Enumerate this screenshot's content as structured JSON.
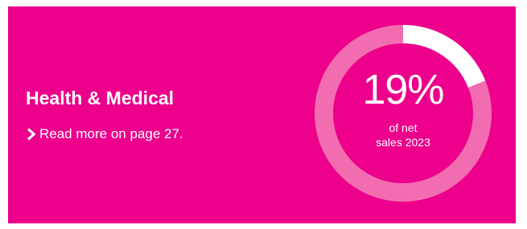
{
  "colors": {
    "background": "#ec008c",
    "ring_track": "#f26daf",
    "ring_value": "#ffffff",
    "text": "#ffffff"
  },
  "card": {
    "title": "Health & Medical",
    "link_text": "Read more on page 27.",
    "link_icon": "chevron-right-icon"
  },
  "chart_data": {
    "type": "pie",
    "values": [
      19,
      81
    ],
    "value_label": "19%",
    "caption_lines": [
      "of net",
      "sales 2023"
    ]
  }
}
